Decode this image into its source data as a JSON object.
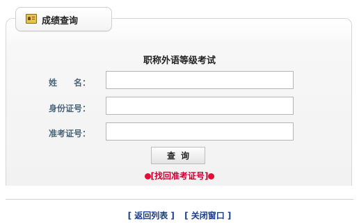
{
  "tab": {
    "title": "成绩查询",
    "icon": "id-card-icon"
  },
  "form": {
    "title": "职称外语等级考试",
    "name_label": "姓　　名：",
    "id_label": "身份证号：",
    "ticket_label": "准考证号：",
    "name_value": "",
    "id_value": "",
    "ticket_value": "",
    "query_button": "查询",
    "find_link": "[找回准考证号]"
  },
  "footer": {
    "back_link": "[ 返回列表 ]",
    "close_link": "[ 关闭窗口 ]"
  },
  "colors": {
    "label": "#4a6577",
    "link_red": "#cc0033",
    "link_blue": "#1a3c8c"
  }
}
